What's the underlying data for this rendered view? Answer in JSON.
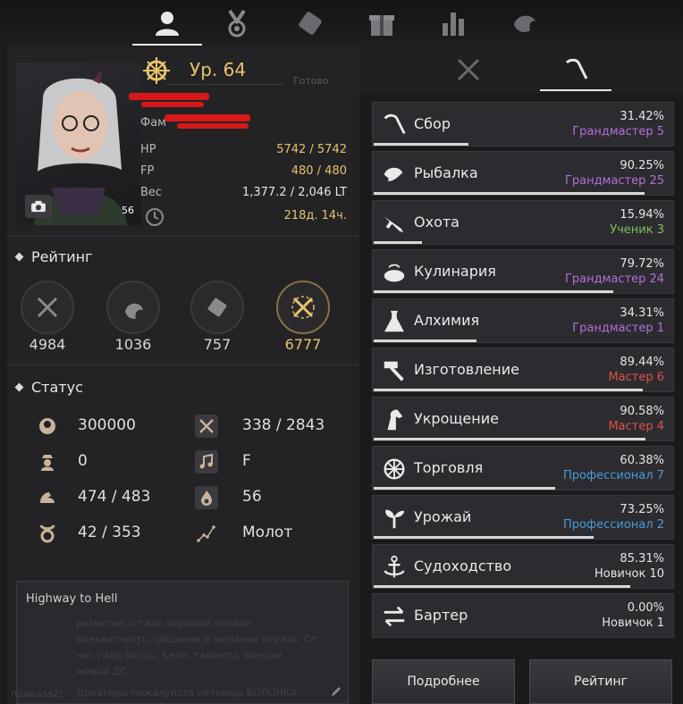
{
  "top_tabs": [
    {
      "name": "profile",
      "icon": "person-icon"
    },
    {
      "name": "achievements",
      "icon": "medal-icon"
    },
    {
      "name": "knowledge",
      "icon": "scroll-icon"
    },
    {
      "name": "rewards",
      "icon": "gift-icon"
    },
    {
      "name": "stats",
      "icon": "bar-chart-icon"
    },
    {
      "name": "guild",
      "icon": "beast-icon"
    }
  ],
  "character": {
    "level": "Ур. 64",
    "ready": "Готово",
    "family_label": "Фам",
    "portrait_number": "56"
  },
  "stats": [
    {
      "label": "HP",
      "value": "5742 / 5742"
    },
    {
      "label": "FP",
      "value": "480 / 480"
    },
    {
      "label": "Вес",
      "value": "1,377.2 / 2,046 LT"
    },
    {
      "label": "",
      "value": "218д. 14ч."
    }
  ],
  "rating": {
    "title": "Рейтинг",
    "items": [
      {
        "value": "4984",
        "icon": "combat-icon"
      },
      {
        "value": "1036",
        "icon": "life-skill-icon"
      },
      {
        "value": "757",
        "icon": "knowledge-icon"
      },
      {
        "value": "6777",
        "icon": "gold-combat-icon"
      }
    ]
  },
  "status": {
    "title": "Статус",
    "left": [
      {
        "icon": "contribution-icon",
        "value": "300000"
      },
      {
        "icon": "rank-icon",
        "value": "0"
      },
      {
        "icon": "strength-icon",
        "value": "474 / 483"
      },
      {
        "icon": "energy-icon",
        "value": "42 / 353"
      }
    ],
    "right": [
      {
        "icon": "tools-icon",
        "value": "338 / 2843"
      },
      {
        "icon": "music-icon",
        "value": "F"
      },
      {
        "icon": "flame-icon",
        "value": "56"
      },
      {
        "icon": "constellation-icon",
        "value": "Молот"
      }
    ]
  },
  "notes": {
    "title": "Highway to Hell",
    "ghost_lines": [
      "развития, от вас хороший онлайн",
      "адекватность, общение и желание играть. От",
      "нас гилд боссы, Белл, таланты, илеции",
      "живой ДС",
      "Донатеры пожалуйста петомцы БОЛОНКА"
    ],
    "ghost_left": "приказа2|"
  },
  "right_tabs": [
    {
      "name": "combat",
      "icon": "crossed-swords-icon"
    },
    {
      "name": "life",
      "icon": "sickle-icon"
    }
  ],
  "skills": [
    {
      "name": "Сбор",
      "pct": "31.42%",
      "rank": "Грандмастер 5",
      "rank_color": "#b46ed8",
      "progress": 31.42,
      "icon": "sickle-icon"
    },
    {
      "name": "Рыбалка",
      "pct": "90.25%",
      "rank": "Грандмастер 25",
      "rank_color": "#b46ed8",
      "progress": 90.25,
      "icon": "fish-icon"
    },
    {
      "name": "Охота",
      "pct": "15.94%",
      "rank": "Ученик 3",
      "rank_color": "#7dbf5a",
      "progress": 15.94,
      "icon": "rifle-icon"
    },
    {
      "name": "Кулинария",
      "pct": "79.72%",
      "rank": "Грандмастер 24",
      "rank_color": "#b46ed8",
      "progress": 79.72,
      "icon": "cooking-icon"
    },
    {
      "name": "Алхимия",
      "pct": "34.31%",
      "rank": "Грандмастер 1",
      "rank_color": "#b46ed8",
      "progress": 34.31,
      "icon": "flask-icon"
    },
    {
      "name": "Изготовление",
      "pct": "89.44%",
      "rank": "Мастер 6",
      "rank_color": "#e0524a",
      "progress": 89.44,
      "icon": "hammer-icon"
    },
    {
      "name": "Укрощение",
      "pct": "90.58%",
      "rank": "Мастер 4",
      "rank_color": "#e0524a",
      "progress": 90.58,
      "icon": "horse-icon"
    },
    {
      "name": "Торговля",
      "pct": "60.38%",
      "rank": "Профессионал 7",
      "rank_color": "#4a9bd8",
      "progress": 60.38,
      "icon": "wheel-icon"
    },
    {
      "name": "Урожай",
      "pct": "73.25%",
      "rank": "Профессионал 2",
      "rank_color": "#4a9bd8",
      "progress": 73.25,
      "icon": "sprout-icon"
    },
    {
      "name": "Судоходство",
      "pct": "85.31%",
      "rank": "Новичок 10",
      "rank_color": "#e6e6e6",
      "progress": 85.31,
      "icon": "anchor-icon"
    },
    {
      "name": "Бартер",
      "pct": "0.00%",
      "rank": "Новичок 1",
      "rank_color": "#e6e6e6",
      "progress": 0,
      "icon": "exchange-icon"
    }
  ],
  "buttons": {
    "details": "Подробнее",
    "rating": "Рейтинг"
  }
}
